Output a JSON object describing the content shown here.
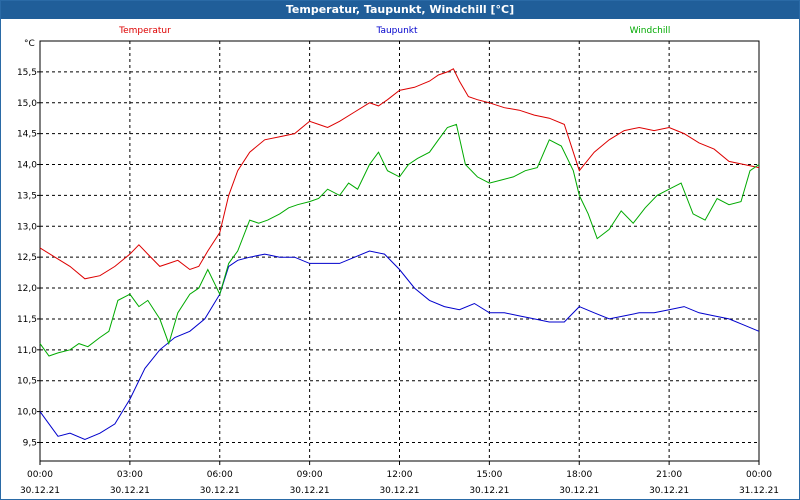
{
  "window": {
    "title": "Temperatur, Taupunkt, Windchill [°C]"
  },
  "chart_data": {
    "type": "line",
    "title": "Temperatur, Taupunkt, Windchill [°C]",
    "ylabel": "°C",
    "ylim": [
      9.2,
      16.0
    ],
    "xlim": [
      0,
      24
    ],
    "grid": true,
    "legend_placement": "top",
    "y_ticks": [
      "9,5",
      "10,0",
      "10,5",
      "11,0",
      "11,5",
      "12,0",
      "12,5",
      "13,0",
      "13,5",
      "14,0",
      "14,5",
      "15,0",
      "15,5"
    ],
    "y_tick_values": [
      9.5,
      10.0,
      10.5,
      11.0,
      11.5,
      12.0,
      12.5,
      13.0,
      13.5,
      14.0,
      14.5,
      15.0,
      15.5
    ],
    "x_ticks": [
      {
        "time": "00:00",
        "date": "30.12.21"
      },
      {
        "time": "03:00",
        "date": "30.12.21"
      },
      {
        "time": "06:00",
        "date": "30.12.21"
      },
      {
        "time": "09:00",
        "date": "30.12.21"
      },
      {
        "time": "12:00",
        "date": "30.12.21"
      },
      {
        "time": "15:00",
        "date": "30.12.21"
      },
      {
        "time": "18:00",
        "date": "30.12.21"
      },
      {
        "time": "21:00",
        "date": "30.12.21"
      },
      {
        "time": "00:00",
        "date": "31.12.21"
      }
    ],
    "series": [
      {
        "name": "Temperatur",
        "color": "#dd0000",
        "x": [
          0,
          0.5,
          1,
          1.5,
          2,
          2.5,
          3,
          3.3,
          3.6,
          4,
          4.3,
          4.6,
          5,
          5.3,
          5.6,
          6,
          6.3,
          6.6,
          7,
          7.5,
          8,
          8.5,
          9,
          9.3,
          9.6,
          10,
          10.5,
          11,
          11.3,
          11.6,
          12,
          12.5,
          13,
          13.3,
          13.6,
          13.8,
          14,
          14.3,
          14.6,
          15,
          15.5,
          16,
          16.5,
          17,
          17.5,
          18,
          18.5,
          19,
          19.5,
          20,
          20.5,
          21,
          21.5,
          22,
          22.5,
          23,
          23.5,
          24
        ],
        "values": [
          12.65,
          12.5,
          12.35,
          12.15,
          12.2,
          12.35,
          12.55,
          12.7,
          12.55,
          12.35,
          12.4,
          12.45,
          12.3,
          12.35,
          12.6,
          12.9,
          13.5,
          13.9,
          14.2,
          14.4,
          14.45,
          14.5,
          14.7,
          14.65,
          14.6,
          14.7,
          14.85,
          15.0,
          14.95,
          15.05,
          15.2,
          15.25,
          15.35,
          15.45,
          15.5,
          15.55,
          15.35,
          15.1,
          15.05,
          15.0,
          14.92,
          14.88,
          14.8,
          14.75,
          14.65,
          13.9,
          14.2,
          14.4,
          14.55,
          14.6,
          14.55,
          14.6,
          14.5,
          14.35,
          14.25,
          14.05,
          14.0,
          13.95
        ]
      },
      {
        "name": "Taupunkt",
        "color": "#0000cc",
        "x": [
          0,
          0.3,
          0.6,
          1,
          1.5,
          2,
          2.5,
          3,
          3.5,
          4,
          4.5,
          5,
          5.5,
          6,
          6.3,
          6.6,
          7,
          7.5,
          8,
          8.5,
          9,
          9.5,
          10,
          10.5,
          11,
          11.5,
          12,
          12.5,
          13,
          13.5,
          14,
          14.5,
          15,
          15.5,
          16,
          16.5,
          17,
          17.5,
          18,
          18.5,
          19,
          19.5,
          20,
          20.5,
          21,
          21.5,
          22,
          22.5,
          23,
          23.5,
          24
        ],
        "values": [
          10.0,
          9.8,
          9.6,
          9.65,
          9.55,
          9.65,
          9.8,
          10.2,
          10.7,
          11.0,
          11.2,
          11.3,
          11.5,
          11.9,
          12.35,
          12.45,
          12.5,
          12.55,
          12.5,
          12.5,
          12.4,
          12.4,
          12.4,
          12.5,
          12.6,
          12.55,
          12.3,
          12.0,
          11.8,
          11.7,
          11.65,
          11.75,
          11.6,
          11.6,
          11.55,
          11.5,
          11.45,
          11.45,
          11.7,
          11.6,
          11.5,
          11.55,
          11.6,
          11.6,
          11.65,
          11.7,
          11.6,
          11.55,
          11.5,
          11.4,
          11.3
        ]
      },
      {
        "name": "Windchill",
        "color": "#00aa00",
        "x": [
          0,
          0.3,
          0.6,
          1,
          1.3,
          1.6,
          2,
          2.3,
          2.6,
          3,
          3.3,
          3.6,
          4,
          4.3,
          4.6,
          5,
          5.3,
          5.6,
          6,
          6.3,
          6.6,
          7,
          7.3,
          7.6,
          8,
          8.3,
          8.6,
          9,
          9.3,
          9.6,
          10,
          10.3,
          10.6,
          11,
          11.3,
          11.6,
          12,
          12.3,
          12.6,
          13,
          13.3,
          13.6,
          13.9,
          14.2,
          14.6,
          15,
          15.4,
          15.8,
          16.2,
          16.6,
          17,
          17.4,
          17.8,
          18,
          18.3,
          18.6,
          19,
          19.4,
          19.8,
          20.2,
          20.6,
          21,
          21.4,
          21.8,
          22.2,
          22.6,
          23,
          23.4,
          23.7,
          24
        ],
        "values": [
          11.1,
          10.9,
          10.95,
          11.0,
          11.1,
          11.05,
          11.2,
          11.3,
          11.8,
          11.9,
          11.7,
          11.8,
          11.5,
          11.1,
          11.6,
          11.9,
          12.0,
          12.3,
          11.9,
          12.4,
          12.6,
          13.1,
          13.05,
          13.1,
          13.2,
          13.3,
          13.35,
          13.4,
          13.45,
          13.6,
          13.5,
          13.7,
          13.6,
          14.0,
          14.2,
          13.9,
          13.8,
          14.0,
          14.1,
          14.2,
          14.4,
          14.6,
          14.65,
          14.0,
          13.8,
          13.7,
          13.75,
          13.8,
          13.9,
          13.95,
          14.4,
          14.3,
          13.9,
          13.5,
          13.2,
          12.8,
          12.95,
          13.25,
          13.05,
          13.3,
          13.5,
          13.6,
          13.7,
          13.2,
          13.1,
          13.45,
          13.35,
          13.4,
          13.9,
          14.0
        ]
      }
    ]
  }
}
